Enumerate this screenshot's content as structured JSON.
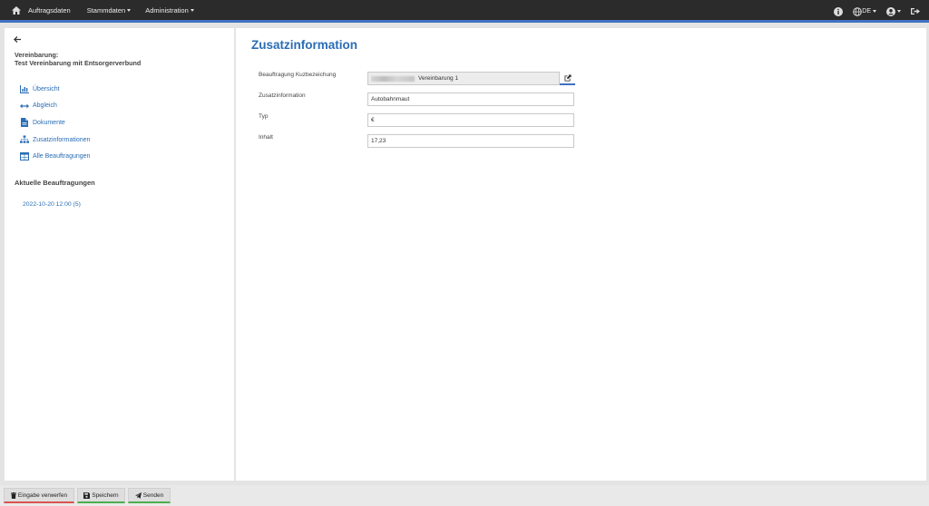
{
  "nav": {
    "items": [
      "Auftragsdaten",
      "Stammdaten",
      "Administration"
    ],
    "language": "DE"
  },
  "sidebar": {
    "agreement_label": "Vereinbarung:",
    "agreement_name": "Test Vereinbarung mit Entsorgerverbund",
    "menu": [
      {
        "label": "Übersicht",
        "icon": "chart-icon"
      },
      {
        "label": "Abgleich",
        "icon": "arrows-horizontal-icon"
      },
      {
        "label": "Dokumente",
        "icon": "document-icon"
      },
      {
        "label": "Zusatzinformationen",
        "icon": "sitemap-icon"
      },
      {
        "label": "Alle Beauftragungen",
        "icon": "table-icon"
      }
    ],
    "current_heading": "Aktuelle Beauftragungen",
    "current_link": "2022-10-20 12:00 (5)"
  },
  "main": {
    "title": "Zusatzinformation",
    "fields": [
      {
        "label": "Beauftragung Kuzbezeichung",
        "value": "Vereinbarung 1"
      },
      {
        "label": "Zusatzinformation",
        "value": "Autobahnmaut"
      },
      {
        "label": "Typ",
        "value": "€"
      },
      {
        "label": "Inhalt",
        "value": "17,23"
      }
    ]
  },
  "footer": {
    "discard": "Eingabe verwerfen",
    "save": "Speichern",
    "send": "Senden"
  },
  "colors": {
    "accent": "#2a6db5",
    "navbar": "#2b2b2b",
    "navbar_border": "#3f72c2",
    "discard_border": "#d9534f",
    "save_border": "#4cae4c"
  }
}
